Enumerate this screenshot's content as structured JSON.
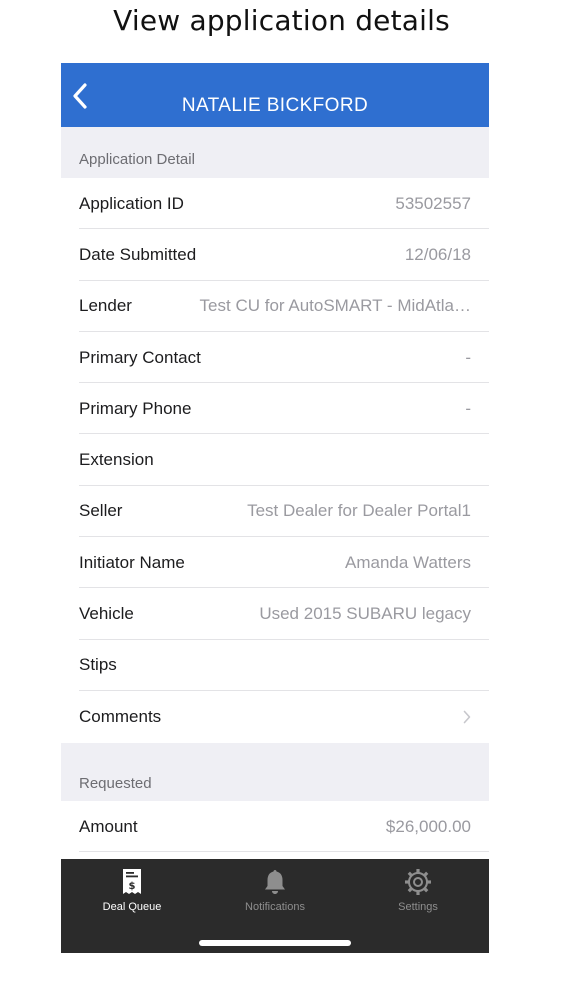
{
  "caption": "View application details",
  "nav": {
    "title": "NATALIE BICKFORD",
    "back_icon": "chevron-left-icon"
  },
  "sections": {
    "application_detail": "Application Detail",
    "requested": "Requested"
  },
  "detail_rows": [
    {
      "label": "Application ID",
      "value": "53502557"
    },
    {
      "label": "Date Submitted",
      "value": "12/06/18"
    },
    {
      "label": "Lender",
      "value": "Test CU for AutoSMART - MidAtla…"
    },
    {
      "label": "Primary Contact",
      "value": "-"
    },
    {
      "label": "Primary Phone",
      "value": "-"
    },
    {
      "label": "Extension",
      "value": ""
    },
    {
      "label": "Seller",
      "value": "Test Dealer for Dealer Portal1"
    },
    {
      "label": "Initiator Name",
      "value": "Amanda Watters"
    },
    {
      "label": "Vehicle",
      "value": "Used 2015 SUBARU legacy"
    },
    {
      "label": "Stips",
      "value": ""
    },
    {
      "label": "Comments",
      "value": ""
    }
  ],
  "requested_rows": [
    {
      "label": "Amount",
      "value": "$26,000.00"
    }
  ],
  "tabs": [
    {
      "label": "Deal Queue",
      "icon": "receipt-dollar-icon",
      "active": true
    },
    {
      "label": "Notifications",
      "icon": "bell-icon",
      "active": false
    },
    {
      "label": "Settings",
      "icon": "gear-icon",
      "active": false
    }
  ],
  "colors": {
    "nav_blue": "#2f6fd0",
    "tabbar_bg": "#2b2b2b",
    "tab_active": "#ffffff",
    "tab_inactive": "#8e8e8e",
    "value_gray": "#9a9aa0"
  }
}
